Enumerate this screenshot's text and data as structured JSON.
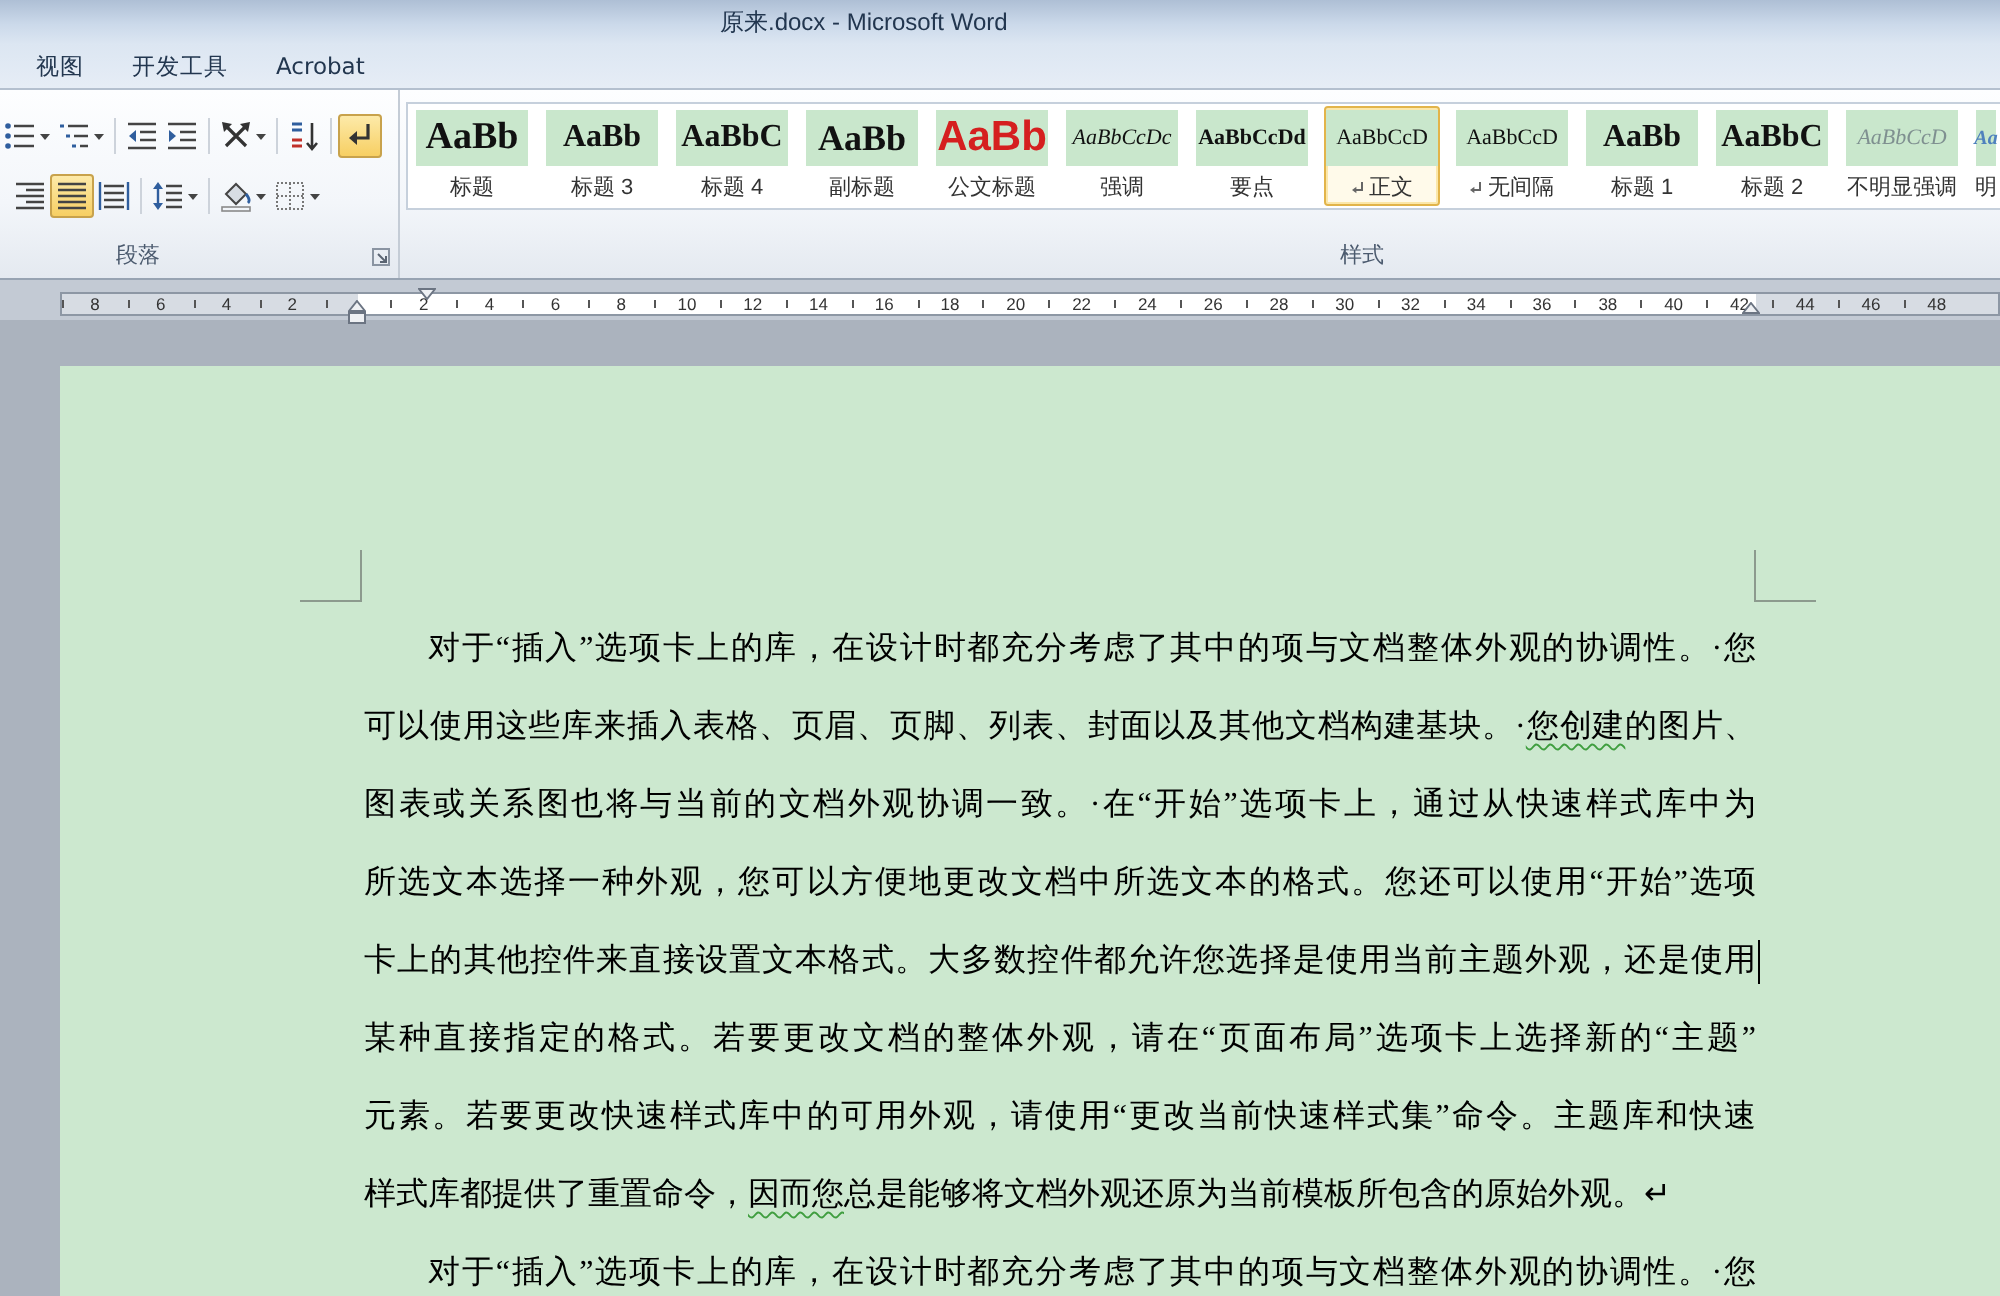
{
  "window": {
    "title": "原来.docx - Microsoft Word"
  },
  "tabs": [
    {
      "label": "视图",
      "selected": false
    },
    {
      "label": "开发工具",
      "selected": false
    },
    {
      "label": "Acrobat",
      "selected": false
    }
  ],
  "ribbon": {
    "paragraph_group": {
      "label": "段落",
      "rows": [
        [
          [
            {
              "kind": "bullets",
              "dropdown": true,
              "selected": false
            },
            {
              "kind": "multilevel",
              "dropdown": true,
              "selected": false
            }
          ],
          [
            {
              "kind": "outdent",
              "dropdown": false,
              "selected": false
            },
            {
              "kind": "indent",
              "dropdown": false,
              "selected": false
            }
          ],
          [
            {
              "kind": "asian_layout",
              "dropdown": true,
              "selected": false
            }
          ],
          [
            {
              "kind": "sort",
              "dropdown": false,
              "selected": false
            }
          ],
          [
            {
              "kind": "show_marks",
              "dropdown": false,
              "selected": true
            }
          ]
        ],
        [
          [
            {
              "kind": "align_right",
              "dropdown": false,
              "selected": false
            },
            {
              "kind": "justify",
              "dropdown": false,
              "selected": true
            },
            {
              "kind": "distribute",
              "dropdown": false,
              "selected": false
            }
          ],
          [
            {
              "kind": "line_spacing",
              "dropdown": true,
              "selected": false
            }
          ],
          [
            {
              "kind": "shading",
              "dropdown": true,
              "selected": false
            },
            {
              "kind": "borders",
              "dropdown": true,
              "selected": false
            }
          ]
        ]
      ]
    },
    "styles_group": {
      "label": "样式",
      "items": [
        {
          "kind": "title",
          "preview": "AaBb",
          "label": "标题",
          "para_mark": false,
          "selected": false
        },
        {
          "kind": "heading",
          "preview": "AaBb",
          "label": "标题 3",
          "para_mark": false,
          "selected": false
        },
        {
          "kind": "heading",
          "preview": "AaBbC",
          "label": "标题 4",
          "para_mark": false,
          "selected": false
        },
        {
          "kind": "subtitle",
          "preview": "AaBb",
          "label": "副标题",
          "para_mark": false,
          "selected": false
        },
        {
          "kind": "official",
          "preview": "AaBb",
          "label": "公文标题",
          "para_mark": false,
          "selected": false
        },
        {
          "kind": "emphasis",
          "preview": "AaBbCcDc",
          "label": "强调",
          "para_mark": false,
          "selected": false
        },
        {
          "kind": "strong",
          "preview": "AaBbCcDd",
          "label": "要点",
          "para_mark": false,
          "selected": false
        },
        {
          "kind": "normal",
          "preview": "AaBbCcD",
          "label": "正文",
          "para_mark": true,
          "selected": true
        },
        {
          "kind": "normal",
          "preview": "AaBbCcD",
          "label": "无间隔",
          "para_mark": true,
          "selected": false
        },
        {
          "kind": "heading",
          "preview": "AaBb",
          "label": "标题 1",
          "para_mark": false,
          "selected": false
        },
        {
          "kind": "heading",
          "preview": "AaBbC",
          "label": "标题 2",
          "para_mark": false,
          "selected": false
        },
        {
          "kind": "subtle",
          "preview": "AaBbCcD",
          "label": "不明显强调",
          "para_mark": false,
          "selected": false
        },
        {
          "kind": "intense",
          "preview": "Aa",
          "label": "明",
          "para_mark": false,
          "selected": false
        }
      ]
    }
  },
  "ruler": {
    "left_labels": [
      "8",
      "6",
      "4",
      "2"
    ],
    "right_labels": [
      "2",
      "4",
      "6",
      "8",
      "10",
      "12",
      "14",
      "16",
      "18",
      "20",
      "22",
      "24",
      "26",
      "28",
      "30",
      "32",
      "34",
      "36",
      "38",
      "40",
      "42",
      "44",
      "46",
      "48"
    ]
  },
  "document": {
    "paragraphs": [
      {
        "lines": [
          {
            "parts": [
              {
                "text": "对于“插入”选项卡上的库，在设计时都充分考虑了其中的项与文档整体外观的协调性。·您",
                "grammar_flag": false
              }
            ],
            "justified": true,
            "cursor": false
          },
          {
            "parts": [
              {
                "text": "可以使用这些库来插入表格、页眉、页脚、列表、封面以及其他文档构建基块。·",
                "grammar_flag": false
              },
              {
                "text": "您创建",
                "grammar_flag": true
              },
              {
                "text": "的图片、",
                "grammar_flag": false
              }
            ],
            "justified": true,
            "cursor": false
          },
          {
            "parts": [
              {
                "text": "图表或关系图也将与当前的文档外观协调一致。·在“开始”选项卡上，通过从快速样式库中为",
                "grammar_flag": false
              }
            ],
            "justified": true,
            "cursor": false
          },
          {
            "parts": [
              {
                "text": "所选文本选择一种外观，您可以方便地更改文档中所选文本的格式。您还可以使用“开始”选项",
                "grammar_flag": false
              }
            ],
            "justified": true,
            "cursor": false
          },
          {
            "parts": [
              {
                "text": "卡上的其他控件来直接设置文本格式。大多数控件都允许您选择是使用当前主题外观，还是使用",
                "grammar_flag": false
              }
            ],
            "justified": true,
            "cursor": true
          },
          {
            "parts": [
              {
                "text": "某种直接指定的格式。若要更改文档的整体外观，请在“页面布局”选项卡上选择新的“主题”",
                "grammar_flag": false
              }
            ],
            "justified": true,
            "cursor": false
          },
          {
            "parts": [
              {
                "text": "元素。若要更改快速样式库中的可用外观，请使用“更改当前快速样式集”命令。主题库和快速",
                "grammar_flag": false
              }
            ],
            "justified": true,
            "cursor": false
          },
          {
            "parts": [
              {
                "text": "样式库都提供了重置命令，",
                "grammar_flag": false
              },
              {
                "text": "因而您",
                "grammar_flag": true
              },
              {
                "text": "总是能够将文档外观还原为当前模板所包含的原始外观。↵",
                "grammar_flag": false
              }
            ],
            "justified": false,
            "cursor": false
          }
        ]
      },
      {
        "lines": [
          {
            "parts": [
              {
                "text": "对于“插入”选项卡上的库，在设计时都充分考虑了其中的项与文档整体外观的协调性。·您",
                "grammar_flag": false
              }
            ],
            "justified": true,
            "cursor": false
          }
        ]
      }
    ]
  }
}
